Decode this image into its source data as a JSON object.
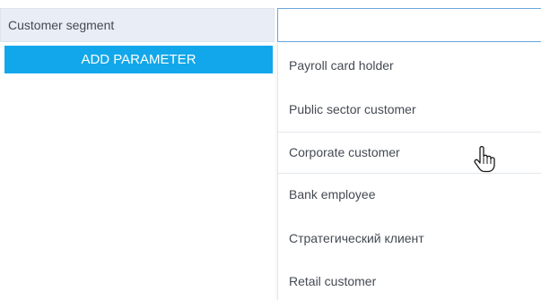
{
  "parameter": {
    "label": "Customer segment",
    "input_value": "",
    "add_button_label": "ADD PARAMETER"
  },
  "dropdown": {
    "items": [
      {
        "label": "Payroll card holder"
      },
      {
        "label": "Public sector customer"
      },
      {
        "label": "Corporate customer",
        "hovered": true
      },
      {
        "label": "Bank employee"
      },
      {
        "label": "Стратегический клиент"
      },
      {
        "label": "Retail customer"
      }
    ]
  },
  "cursor": {
    "icon": "hand-pointer-icon"
  },
  "colors": {
    "accent": "#12a7ea",
    "label_background": "#e9eef6",
    "input_border": "#6aa6de",
    "text": "#444a52"
  }
}
